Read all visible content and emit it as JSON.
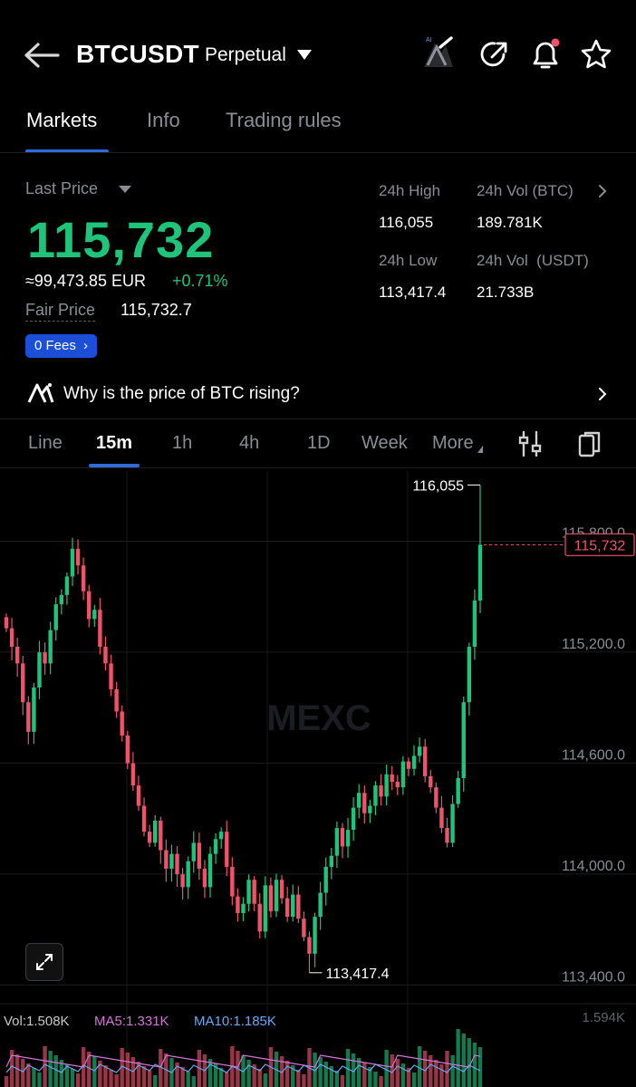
{
  "header": {
    "title": "BTCUSDT",
    "subtitle": "Perpetual"
  },
  "tabs": [
    "Markets",
    "Info",
    "Trading rules"
  ],
  "price": {
    "last_price_label": "Last Price",
    "last_price": "115,732",
    "converted": "≈99,473.85 EUR",
    "change": "+0.71%",
    "fair_price_label": "Fair Price",
    "fair_price": "115,732.7",
    "fees_label": "0 Fees"
  },
  "stats": {
    "high_label": "24h High",
    "high": "116,055",
    "vol_btc_label": "24h Vol (BTC)",
    "vol_btc": "189.781K",
    "low_label": "24h Low",
    "low": "113,417.4",
    "vol_usdt_label": "24h Vol  (USDT)",
    "vol_usdt": "21.733B"
  },
  "banner": {
    "text": "Why is the price of BTC rising?"
  },
  "chart_tabs": [
    "Line",
    "15m",
    "1h",
    "4h",
    "1D",
    "Week",
    "More"
  ],
  "chart_data": {
    "type": "candlestick",
    "interval": "15m",
    "watermark": "MEXC",
    "y_ticks": [
      "115,800.0",
      "115,200.0",
      "114,600.0",
      "114,000.0",
      "113,400.0"
    ],
    "ylim": [
      113250,
      116150
    ],
    "high_marker": "116,055",
    "low_marker": "113,417.4",
    "current_price_tag": "115,732",
    "closes": [
      115280,
      115180,
      115090,
      114880,
      114720,
      114960,
      115150,
      115090,
      115270,
      115410,
      115460,
      115560,
      115710,
      115620,
      115480,
      115330,
      115380,
      115180,
      115090,
      114950,
      114830,
      114700,
      114550,
      114430,
      114320,
      114180,
      114120,
      114240,
      114080,
      113980,
      114060,
      113950,
      113880,
      114020,
      114120,
      113980,
      113880,
      114060,
      114140,
      114180,
      113990,
      113830,
      113740,
      113790,
      113920,
      113790,
      113640,
      113890,
      113750,
      113920,
      113820,
      113720,
      113840,
      113710,
      113610,
      113520,
      113720,
      113850,
      113990,
      114050,
      114200,
      114100,
      114190,
      114310,
      114390,
      114280,
      114320,
      114430,
      114370,
      114490,
      114450,
      114420,
      114560,
      114520,
      114590,
      114640,
      114480,
      114420,
      114310,
      114200,
      114120,
      114330,
      114470,
      114880,
      115180,
      115430,
      115732
    ],
    "volume_label": "Vol:1.508K",
    "ma5_label": "MA5:1.331K",
    "ma10_label": "MA10:1.185K",
    "volume_max_label": "1.594K",
    "colors": {
      "up": "#1dc47a",
      "down": "#f0526a"
    }
  }
}
